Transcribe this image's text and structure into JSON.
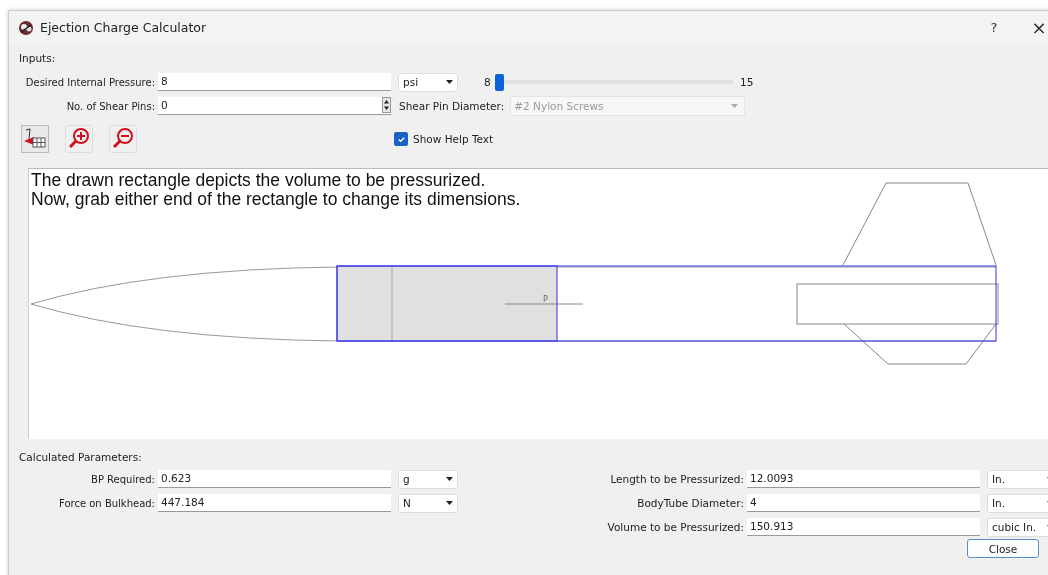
{
  "window": {
    "title": "Ejection Charge Calculator",
    "help_button": "?",
    "close_button": "×"
  },
  "inputs": {
    "heading": "Inputs:",
    "pressure": {
      "label": "Desired Internal Pressure:",
      "value": "8",
      "unit": "psi",
      "slider_min": "8",
      "slider_max": "15",
      "level": 0
    },
    "shear_pins": {
      "label": "No. of Shear Pins:",
      "value": "0",
      "diameter_label": "Shear Pin Diameter:",
      "diameter_value": "#2 Nylon Screws",
      "diameter_disabled": true
    }
  },
  "show_help_text": {
    "label": "Show Help Text",
    "checked": true
  },
  "help_text": [
    "The drawn rectangle depicts the volume to be pressurized.",
    "Now, grab either end of the rectangle to change its dimensions."
  ],
  "drawing": {
    "pressure_marker": "P"
  },
  "calculated": {
    "heading": "Calculated Parameters:",
    "left": [
      {
        "label": "BP Required:",
        "value": "0.623",
        "unit": "g"
      },
      {
        "label": "Force on Bulkhead:",
        "value": "447.184",
        "unit": "N"
      }
    ],
    "right": [
      {
        "label": "Length to be Pressurized:",
        "value": "12.0093",
        "unit": "In."
      },
      {
        "label": "BodyTube Diameter:",
        "value": "4",
        "unit": "In."
      },
      {
        "label": "Volume to be Pressurized:",
        "value": "150.913",
        "unit": "cubic In."
      }
    ]
  },
  "close": "Close"
}
